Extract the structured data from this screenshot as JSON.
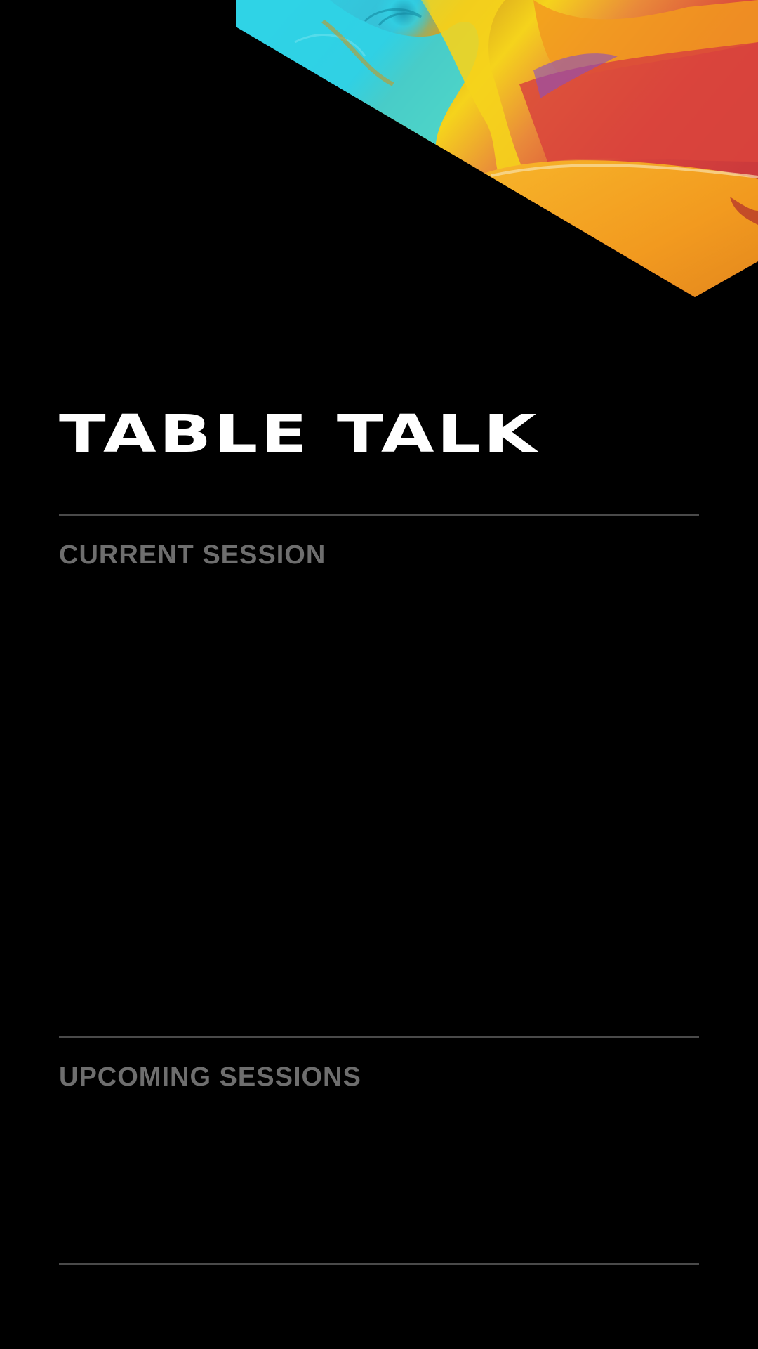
{
  "app": {
    "title": "TABLE TALK"
  },
  "sections": {
    "current": {
      "label": "CURRENT SESSION"
    },
    "upcoming": {
      "label": "UPCOMING SESSIONS"
    }
  },
  "theme": {
    "background": "#000000",
    "title_color": "#ffffff",
    "label_color": "#6e6e6e",
    "divider_color": "#4a4a4a",
    "art_colors": [
      "#2fd3e6",
      "#f5d31c",
      "#f29a1f",
      "#d9443c",
      "#8a4fc0",
      "#f7b52a"
    ]
  }
}
